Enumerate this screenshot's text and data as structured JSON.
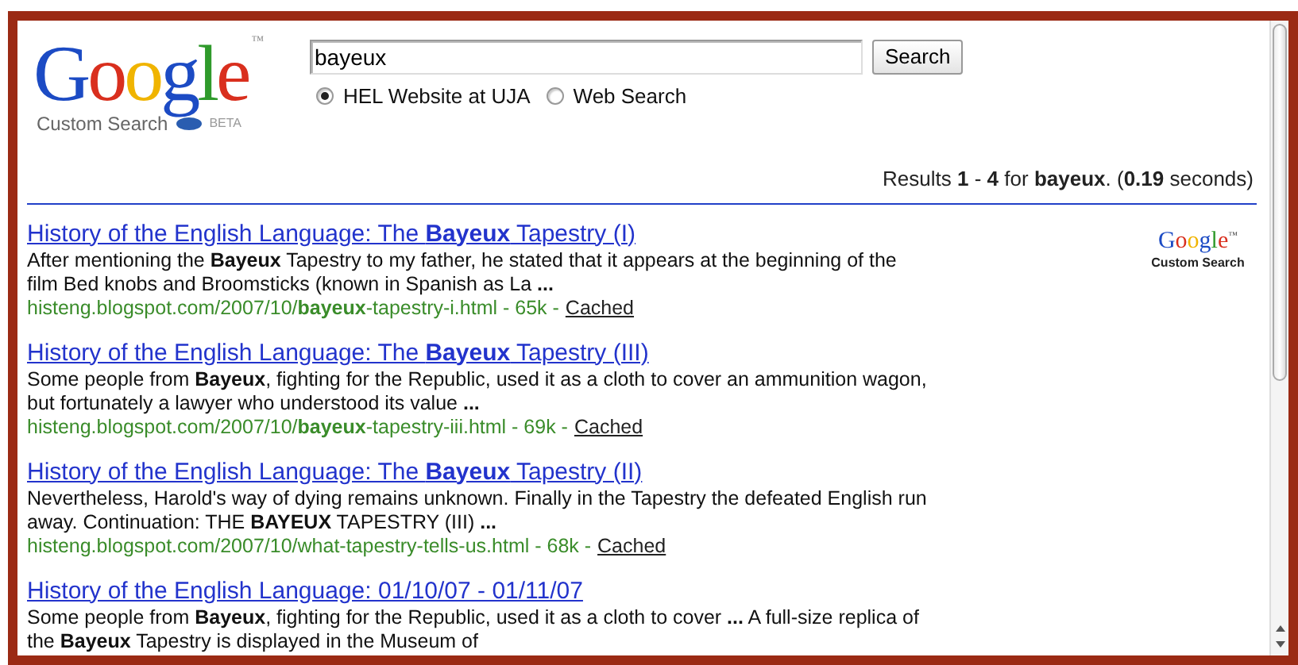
{
  "logo": {
    "word": "Google",
    "trademark": "™",
    "subtitle": "Custom Search",
    "badge": "BETA"
  },
  "search": {
    "value": "bayeux",
    "button": "Search"
  },
  "scopes": [
    {
      "label": "HEL Website at UJA",
      "selected": true
    },
    {
      "label": "Web Search",
      "selected": false
    }
  ],
  "summary": "Results **1** - **4** for **bayeux**. (**0.19** seconds)",
  "side_logo": {
    "word": "Google",
    "trademark": "™",
    "subtitle": "Custom Search"
  },
  "results": [
    {
      "title": "History of the English Language: The **Bayeux** Tapestry (I)",
      "snippet": "After mentioning the **Bayeux** Tapestry to my father, he stated that it appears at the beginning of the film Bed knobs and Broomsticks (known in Spanish as La **...**",
      "url": "histeng.blogspot.com/2007/10/**bayeux**-tapestry-i.html - 65k -",
      "cached": "Cached"
    },
    {
      "title": "History of the English Language: The **Bayeux** Tapestry (III)",
      "snippet": "Some people from **Bayeux**, fighting for the Republic, used it as a cloth to cover an ammunition wagon, but fortunately a lawyer who understood its value **...**",
      "url": "histeng.blogspot.com/2007/10/**bayeux**-tapestry-iii.html - 69k -",
      "cached": "Cached"
    },
    {
      "title": "History of the English Language: The **Bayeux** Tapestry (II)",
      "snippet": "Nevertheless, Harold's way of dying remains unknown. Finally in the Tapestry the defeated English run away. Continuation: THE **BAYEUX** TAPESTRY (III) **...**",
      "url": "histeng.blogspot.com/2007/10/what-tapestry-tells-us.html - 68k -",
      "cached": "Cached"
    },
    {
      "title": "History of the English Language: 01/10/07 - 01/11/07",
      "snippet": "Some people from **Bayeux**, fighting for the Republic, used it as a cloth to cover **...** A full-size replica of the **Bayeux** Tapestry is displayed in the Museum of"
    }
  ]
}
